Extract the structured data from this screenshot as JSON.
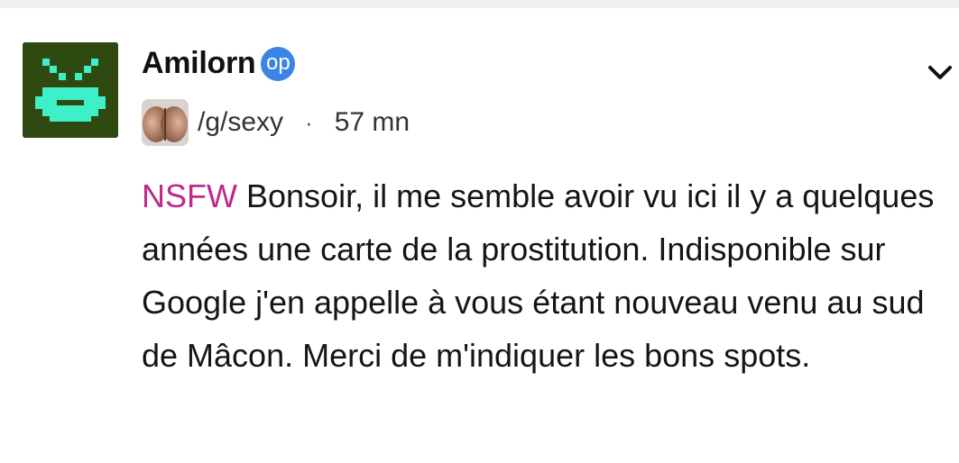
{
  "post": {
    "author": "Amilorn",
    "op_badge": "op",
    "community": "/g/sexy",
    "separator": "·",
    "time": "57 mn",
    "nsfw_tag": "NSFW",
    "body_text": "Bonsoir, il me semble avoir vu ici il y a quelques années une carte de la prostitution. Indisponible sur Google j'en appelle à vous étant nouveau venu au sud de Mâcon. Merci de m'indiquer les bons spots."
  },
  "icons": {
    "avatar": "pixel-space-invader-avatar",
    "community": "community-avatar-image",
    "chevron": "chevron-down-icon"
  },
  "colors": {
    "nsfw": "#c0288b",
    "op_badge": "#3a84e6",
    "avatar_bg": "#2f4a10",
    "avatar_pixels": "#3ef0c8"
  }
}
